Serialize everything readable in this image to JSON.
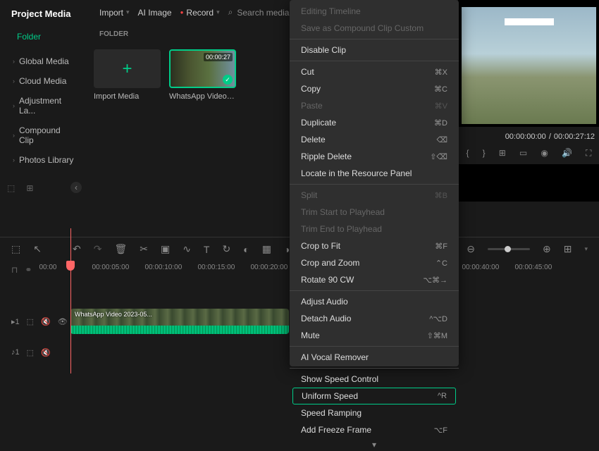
{
  "sidebar": {
    "title": "Project Media",
    "tab": "Folder",
    "items": [
      "Global Media",
      "Cloud Media",
      "Adjustment La...",
      "Compound Clip",
      "Photos Library"
    ]
  },
  "toolbar": {
    "import": "Import",
    "ai_image": "AI Image",
    "record": "Record",
    "search_placeholder": "Search media"
  },
  "folder_label": "FOLDER",
  "media": {
    "import_label": "Import Media",
    "video_label": "WhatsApp Video 202...",
    "video_duration": "00:00:27"
  },
  "preview": {
    "current": "00:00:00:00",
    "sep": "/",
    "total": "00:00:27:12"
  },
  "ruler": [
    "00:00",
    "00:00:05:00",
    "00:00:10:00",
    "00:00:15:00",
    "00:00:20:00",
    "",
    "",
    "",
    "00:00:40:00",
    "00:00:45:00"
  ],
  "clip_label": "WhatsApp Video 2023-05...",
  "ctx": {
    "items": [
      {
        "label": "Editing Timeline",
        "disabled": true
      },
      {
        "label": "Save as Compound Clip Custom",
        "disabled": true
      },
      {
        "sep": true
      },
      {
        "label": "Disable Clip"
      },
      {
        "sep": true
      },
      {
        "label": "Cut",
        "key": "⌘X"
      },
      {
        "label": "Copy",
        "key": "⌘C"
      },
      {
        "label": "Paste",
        "key": "⌘V",
        "disabled": true
      },
      {
        "label": "Duplicate",
        "key": "⌘D"
      },
      {
        "label": "Delete",
        "key": "⌫"
      },
      {
        "label": "Ripple Delete",
        "key": "⇧⌫"
      },
      {
        "label": "Locate in the Resource Panel"
      },
      {
        "sep": true
      },
      {
        "label": "Split",
        "key": "⌘B",
        "disabled": true
      },
      {
        "label": "Trim Start to Playhead",
        "disabled": true
      },
      {
        "label": "Trim End to Playhead",
        "disabled": true
      },
      {
        "label": "Crop to Fit",
        "key": "⌘F"
      },
      {
        "label": "Crop and Zoom",
        "key": "⌃C"
      },
      {
        "label": "Rotate 90 CW",
        "key": "⌥⌘→"
      },
      {
        "sep": true
      },
      {
        "label": "Adjust Audio"
      },
      {
        "label": "Detach Audio",
        "key": "^⌥D"
      },
      {
        "label": "Mute",
        "key": "⇧⌘M"
      },
      {
        "sep": true
      },
      {
        "label": "AI Vocal Remover"
      },
      {
        "sep": true
      },
      {
        "label": "Show Speed Control"
      },
      {
        "label": "Uniform Speed",
        "key": "^R",
        "hl": true
      },
      {
        "label": "Speed Ramping"
      },
      {
        "label": "Add Freeze Frame",
        "key": "⌥F"
      }
    ]
  }
}
